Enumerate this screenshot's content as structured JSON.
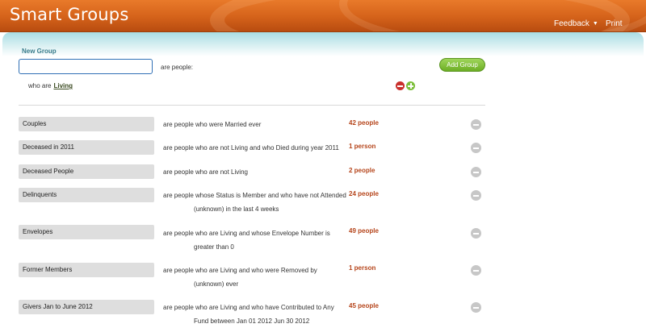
{
  "header": {
    "title": "Smart Groups",
    "feedback_label": "Feedback",
    "print_label": "Print",
    "accent_color": "#d4621a"
  },
  "new_group": {
    "section_label": "New Group",
    "name_value": "",
    "are_people_text": "are people:",
    "add_group_label": "Add Group",
    "criteria": {
      "prefix": "who are",
      "value": "Living"
    }
  },
  "groups": [
    {
      "name": "Couples",
      "desc1": "are people who were Married ever",
      "desc2": "",
      "count": "42 people"
    },
    {
      "name": "Deceased in 2011",
      "desc1": "are people who are not Living and who Died during year 2011",
      "desc2": "",
      "count": "1 person"
    },
    {
      "name": "Deceased People",
      "desc1": "are people who are not Living",
      "desc2": "",
      "count": "2 people"
    },
    {
      "name": "Delinquents",
      "desc1": "are people whose Status is Member and who have not Attended",
      "desc2": "(unknown) in the last 4 weeks",
      "count": "24 people"
    },
    {
      "name": "Envelopes",
      "desc1": "are people who are Living and whose Envelope Number is",
      "desc2": "greater than 0",
      "count": "49 people"
    },
    {
      "name": "Former Members",
      "desc1": "are people who are Living and who were Removed by",
      "desc2": "(unknown) ever",
      "count": "1 person"
    },
    {
      "name": "Givers Jan to June 2012",
      "desc1": "are people who are Living and who have Contributed to Any",
      "desc2": "Fund between Jan 01 2012 Jun 30 2012",
      "count": "45 people"
    }
  ]
}
